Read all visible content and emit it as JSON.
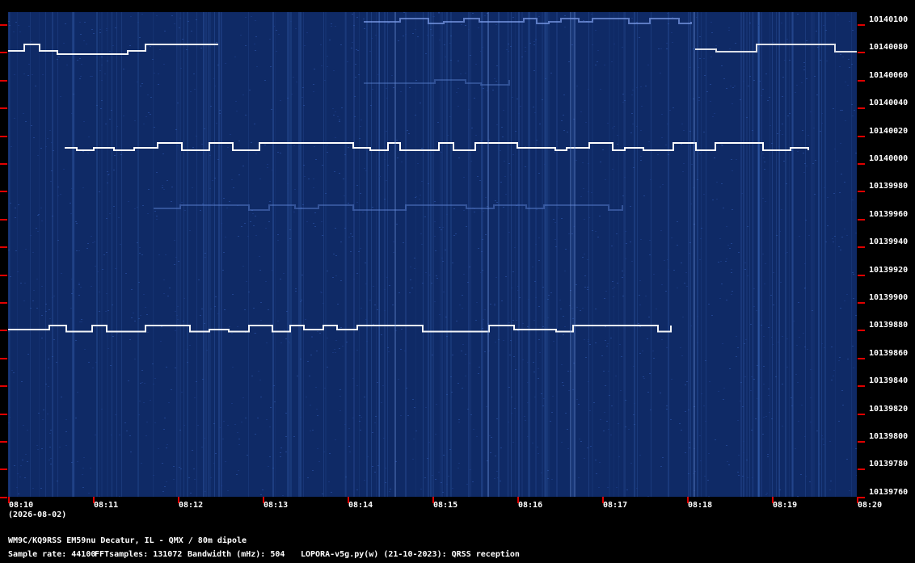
{
  "freq_labels": [
    "10140100",
    "10140080",
    "10140060",
    "10140040",
    "10140020",
    "10140000",
    "10139980",
    "10139960",
    "10139940",
    "10139920",
    "10139900",
    "10139880",
    "10139860",
    "10139840",
    "10139820",
    "10139800",
    "10139780",
    "10139760"
  ],
  "time_labels": [
    "08:10",
    "08:11",
    "08:12",
    "08:13",
    "08:14",
    "08:15",
    "08:16",
    "08:17",
    "08:18",
    "08:19",
    "08:20"
  ],
  "date_label": "(2026-08-02)",
  "station_line": "WM9C/KQ9RSS EM59nu Decatur, IL - QMX / 80m dipole",
  "sample_rate": "Sample rate: 44100",
  "fft_samples": "FFTsamples: 131072",
  "bandwidth": "Bandwidth (mHz): 504",
  "software": "LOPORA-v5g.py(w) (21-10-2023): QRSS reception",
  "colors": {
    "waterfall_bg": "#0f2a66",
    "marker": "#e00000",
    "signal": "#ffffff"
  }
}
